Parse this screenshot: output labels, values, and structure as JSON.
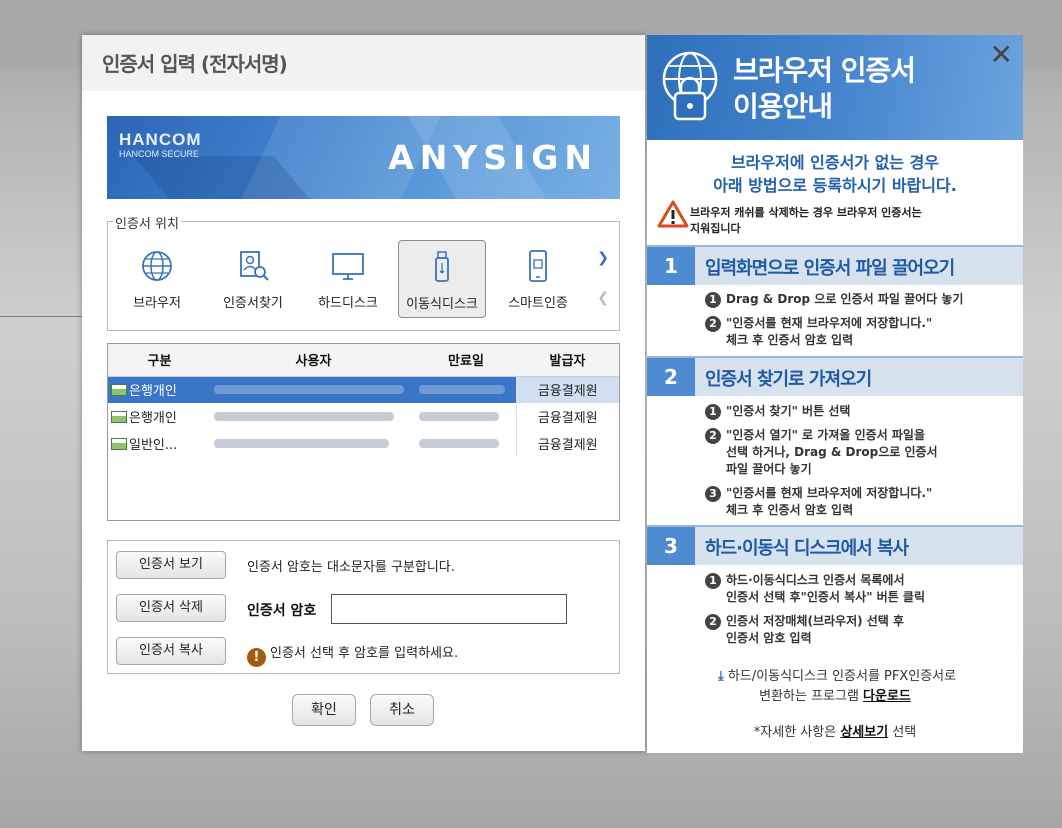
{
  "dialog": {
    "title": "인증서 입력 (전자서명)",
    "banner": {
      "logo": "HANCOM",
      "sub": "HANCOM SECURE",
      "product": "ANYSIGN"
    },
    "location_legend": "인증서 위치",
    "locations": [
      {
        "label": "브라우저",
        "icon": "globe-icon"
      },
      {
        "label": "인증서찾기",
        "icon": "cert-search-icon"
      },
      {
        "label": "하드디스크",
        "icon": "monitor-icon"
      },
      {
        "label": "이동식디스크",
        "icon": "usb-icon",
        "selected": true
      },
      {
        "label": "스마트인증",
        "icon": "smartphone-icon"
      }
    ],
    "table": {
      "headers": [
        "구분",
        "사용자",
        "만료일",
        "발급자"
      ],
      "rows": [
        {
          "type": "은행개인",
          "issuer": "금융결제원",
          "selected": true
        },
        {
          "type": "은행개인",
          "issuer": "금융결제원"
        },
        {
          "type": "일반인...",
          "issuer": "금융결제원"
        }
      ]
    },
    "buttons": {
      "view": "인증서 보기",
      "delete": "인증서 삭제",
      "copy": "인증서 복사",
      "ok": "확인",
      "cancel": "취소"
    },
    "password": {
      "info": "인증서 암호는 대소문자를 구분합니다.",
      "label": "인증서 암호",
      "value": "",
      "warning": "인증서 선택 후 암호를 입력하세요."
    }
  },
  "guide": {
    "title_line1": "브라우저 인증서",
    "title_line2": "이용안내",
    "lead_line1": "브라우저에 인증서가 없는 경우",
    "lead_line2": "아래 방법으로 등록하시기 바랍니다.",
    "caution_line1": "브라우저 캐쉬를 삭제하는 경우 브라우저 인증서는",
    "caution_line2": "지워집니다",
    "steps": [
      {
        "num": "1",
        "title": "입력화면으로 인증서 파일 끌어오기",
        "items": [
          {
            "n": "1",
            "lines": [
              "Drag & Drop 으로 인증서 파일 끌어다 놓기"
            ]
          },
          {
            "n": "2",
            "lines": [
              "\"인증서를 현재 브라우저에 저장합니다.\"",
              "체크 후 인증서 암호 입력"
            ]
          }
        ]
      },
      {
        "num": "2",
        "title": "인증서 찾기로 가져오기",
        "items": [
          {
            "n": "1",
            "lines": [
              "\"인증서 찾기\" 버튼 선택"
            ]
          },
          {
            "n": "2",
            "lines": [
              "\"인증서 열기\" 로 가져올 인증서 파일을",
              "선택 하거나, Drag & Drop으로 인증서",
              "파일 끌어다 놓기"
            ]
          },
          {
            "n": "3",
            "lines": [
              "\"인증서를 현재 브라우저에 저장합니다.\"",
              "체크 후 인증서 암호 입력"
            ]
          }
        ]
      },
      {
        "num": "3",
        "title": "하드·이동식 디스크에서 복사",
        "items": [
          {
            "n": "1",
            "lines": [
              "하드·이동식디스크 인증서 목록에서",
              "인증서 선택 후\"인증서 복사\" 버튼 클릭"
            ]
          },
          {
            "n": "2",
            "lines": [
              "인증서 저장매체(브라우저) 선택 후",
              "인증서 암호 입력"
            ]
          }
        ]
      }
    ],
    "footer": {
      "line1": "하드/이동식디스크 인증서를 PFX인증서로",
      "line2_prefix": "변환하는 프로그램 ",
      "download_link": "다운로드",
      "detail_prefix": "*자세한 사항은 ",
      "detail_link": "상세보기",
      "detail_suffix": " 선택"
    },
    "close_icon": "close-icon"
  },
  "colors": {
    "accent": "#3a75c8",
    "guide_blue": "#4f8bd0",
    "guide_text": "#2160ad",
    "warning": "#a35c11"
  }
}
